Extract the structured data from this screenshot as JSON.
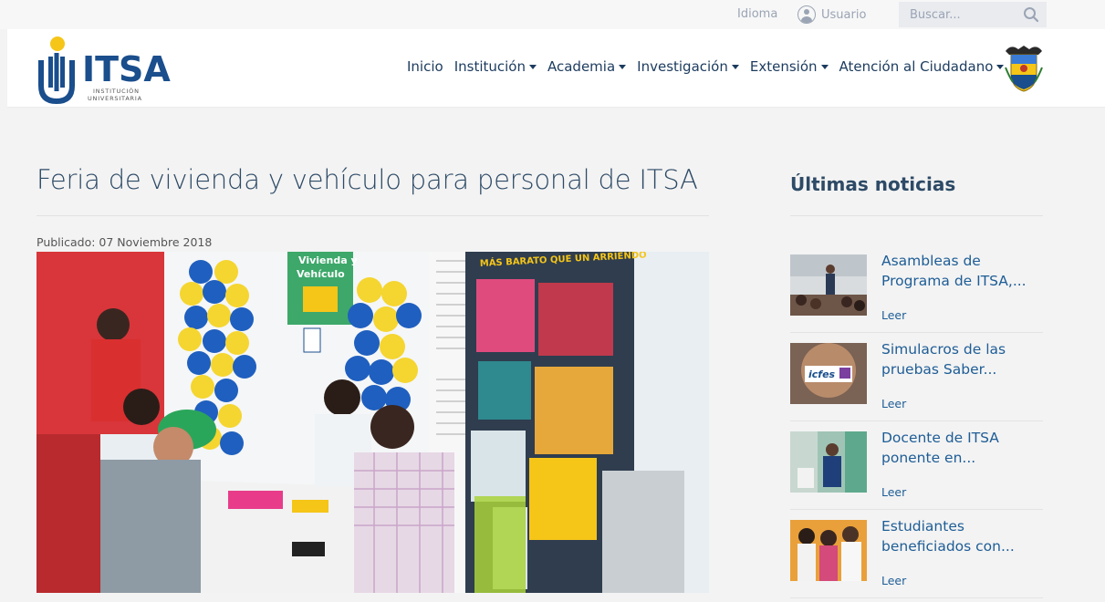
{
  "utility": {
    "language_label": "Idioma",
    "user_label": "Usuario",
    "search_placeholder": "Buscar..."
  },
  "header": {
    "logo_text": "ITSA",
    "logo_sub1": "INSTITUCIÓN",
    "logo_sub2": "UNIVERSITARIA",
    "nav": [
      {
        "label": "Inicio",
        "dropdown": false
      },
      {
        "label": "Institución",
        "dropdown": true
      },
      {
        "label": "Academia",
        "dropdown": true
      },
      {
        "label": "Investigación",
        "dropdown": true
      },
      {
        "label": "Extensión",
        "dropdown": true
      },
      {
        "label": "Atención al Ciudadano",
        "dropdown": true
      }
    ]
  },
  "article": {
    "title": "Feria de vivienda y vehículo para personal de ITSA",
    "published": "Publicado: 07 Noviembre 2018",
    "image_sign_1": "Vivienda y",
    "image_sign_2": "Vehículo",
    "image_banner": "MÁS BARATO QUE UN ARRIENDO"
  },
  "sidebar": {
    "title": "Últimas noticias",
    "items": [
      {
        "title": "Asambleas de Programa de ITSA,...",
        "read": "Leer"
      },
      {
        "title": "Simulacros de las pruebas Saber...",
        "read": "Leer"
      },
      {
        "title": "Docente de ITSA ponente en...",
        "read": "Leer"
      },
      {
        "title": "Estudiantes beneficiados con...",
        "read": "Leer"
      }
    ]
  },
  "colors": {
    "brand_blue": "#1a4e8c",
    "brand_yellow": "#f5c518",
    "link_blue": "#1e5d96",
    "title_blue": "#2d4a66"
  }
}
